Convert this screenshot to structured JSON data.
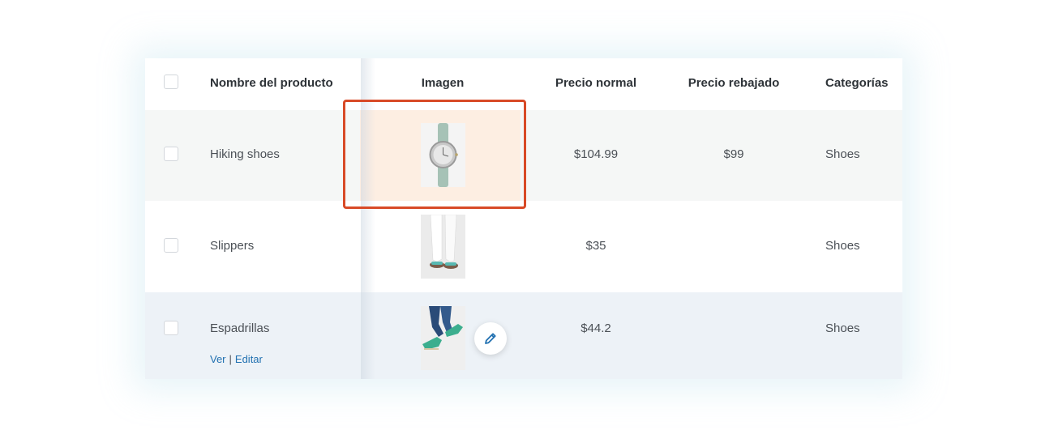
{
  "table": {
    "headers": {
      "name": "Nombre del producto",
      "image": "Imagen",
      "regular_price": "Precio normal",
      "sale_price": "Precio rebajado",
      "categories": "Categorías"
    },
    "rows": [
      {
        "name": "Hiking shoes",
        "image_icon": "watch-product-image",
        "regular_price": "$104.99",
        "sale_price": "$99",
        "categories": "Shoes"
      },
      {
        "name": "Slippers",
        "image_icon": "sandals-product-image",
        "regular_price": "$35",
        "sale_price": "",
        "categories": "Shoes"
      },
      {
        "name": "Espadrillas",
        "image_icon": "espadrilles-product-image",
        "regular_price": "$44.2",
        "sale_price": "",
        "categories": "Shoes",
        "actions": {
          "view": "Ver",
          "separator": "|",
          "edit": "Editar"
        }
      }
    ]
  },
  "colors": {
    "highlight_cell": "#fdeee2",
    "callout_border": "#d84a27",
    "link": "#2271b1"
  }
}
